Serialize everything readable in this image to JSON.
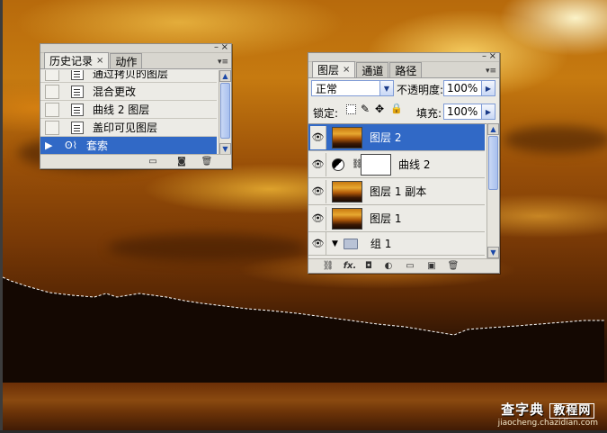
{
  "history_panel": {
    "tabs": [
      {
        "label": "历史记录",
        "close": "×"
      },
      {
        "label": "动作"
      }
    ],
    "items": [
      {
        "label": "通过拷贝的图层"
      },
      {
        "label": "混合更改"
      },
      {
        "label": "曲线 2 图层"
      },
      {
        "label": "盖印可见图层"
      },
      {
        "label": "套索",
        "selected": true
      }
    ],
    "footer_icons": [
      "new-document-from-state-icon",
      "snapshot-icon",
      "trash-icon"
    ]
  },
  "layers_panel": {
    "tabs": [
      {
        "label": "图层",
        "close": "×"
      },
      {
        "label": "通道"
      },
      {
        "label": "路径"
      }
    ],
    "blend_mode": "正常",
    "opacity_label": "不透明度:",
    "opacity_value": "100%",
    "lock_label": "锁定:",
    "fill_label": "填充:",
    "fill_value": "100%",
    "layers": [
      {
        "label": "图层 2",
        "selected": true,
        "kind": "image"
      },
      {
        "label": "曲线 2",
        "kind": "adjustment"
      },
      {
        "label": "图层 1 副本",
        "kind": "image"
      },
      {
        "label": "图层 1",
        "kind": "image"
      },
      {
        "label": "组 1",
        "kind": "group"
      }
    ],
    "footer_icons": [
      "link-icon",
      "fx-icon",
      "mask-icon",
      "adjustment-layer-icon",
      "folder-icon",
      "new-layer-icon",
      "trash-icon"
    ],
    "fx_label": "fx."
  },
  "watermark": {
    "main": "查字典",
    "boxed": "教程网",
    "url": "jiaocheng.chazidian.com"
  },
  "colors": {
    "selection": "#3169c6",
    "panel_bg": "#ecebe6"
  }
}
